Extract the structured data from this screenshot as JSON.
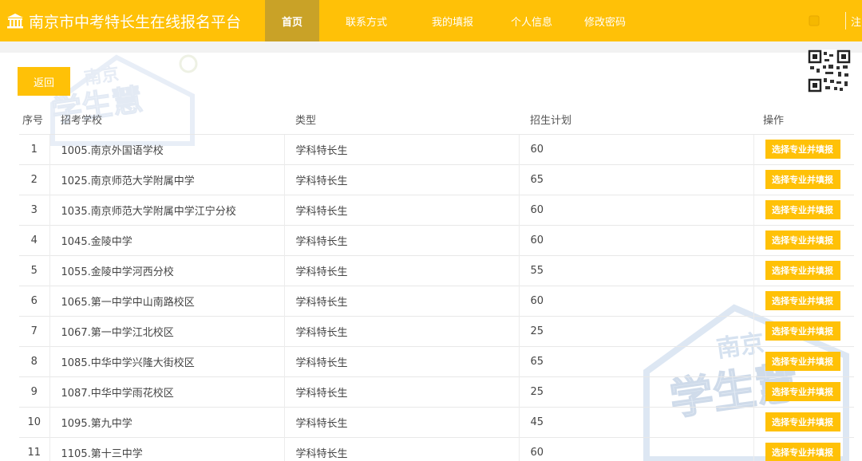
{
  "brand": {
    "title": "南京市中考特长生在线报名平台",
    "icon": "bank-icon"
  },
  "nav": {
    "items": [
      {
        "label": "首页",
        "active": true
      },
      {
        "label": "联系方式",
        "active": false
      },
      {
        "label": "我的填报",
        "active": false
      },
      {
        "label": "个人信息",
        "active": false
      },
      {
        "label": "修改密码",
        "active": false
      }
    ],
    "logout_label": "注"
  },
  "page": {
    "back_label": "返回"
  },
  "table": {
    "headers": {
      "index": "序号",
      "school": "招考学校",
      "type": "类型",
      "plan": "招生计划",
      "op": "操作"
    },
    "action_label": "选择专业并填报",
    "rows": [
      {
        "index": "1",
        "school": "1005.南京外国语学校",
        "type": "学科特长生",
        "plan": "60"
      },
      {
        "index": "2",
        "school": "1025.南京师范大学附属中学",
        "type": "学科特长生",
        "plan": "65"
      },
      {
        "index": "3",
        "school": "1035.南京师范大学附属中学江宁分校",
        "type": "学科特长生",
        "plan": "60"
      },
      {
        "index": "4",
        "school": "1045.金陵中学",
        "type": "学科特长生",
        "plan": "60"
      },
      {
        "index": "5",
        "school": "1055.金陵中学河西分校",
        "type": "学科特长生",
        "plan": "55"
      },
      {
        "index": "6",
        "school": "1065.第一中学中山南路校区",
        "type": "学科特长生",
        "plan": "60"
      },
      {
        "index": "7",
        "school": "1067.第一中学江北校区",
        "type": "学科特长生",
        "plan": "25"
      },
      {
        "index": "8",
        "school": "1085.中华中学兴隆大街校区",
        "type": "学科特长生",
        "plan": "65"
      },
      {
        "index": "9",
        "school": "1087.中华中学雨花校区",
        "type": "学科特长生",
        "plan": "25"
      },
      {
        "index": "10",
        "school": "1095.第九中学",
        "type": "学科特长生",
        "plan": "45"
      },
      {
        "index": "11",
        "school": "1105.第十三中学",
        "type": "学科特长生",
        "plan": "60"
      }
    ]
  },
  "watermark": {
    "line1": "南京",
    "line2": "学生慧"
  },
  "colors": {
    "accent": "#ffc107",
    "active_nav": "#c9a227",
    "panel": "#ffffff"
  }
}
